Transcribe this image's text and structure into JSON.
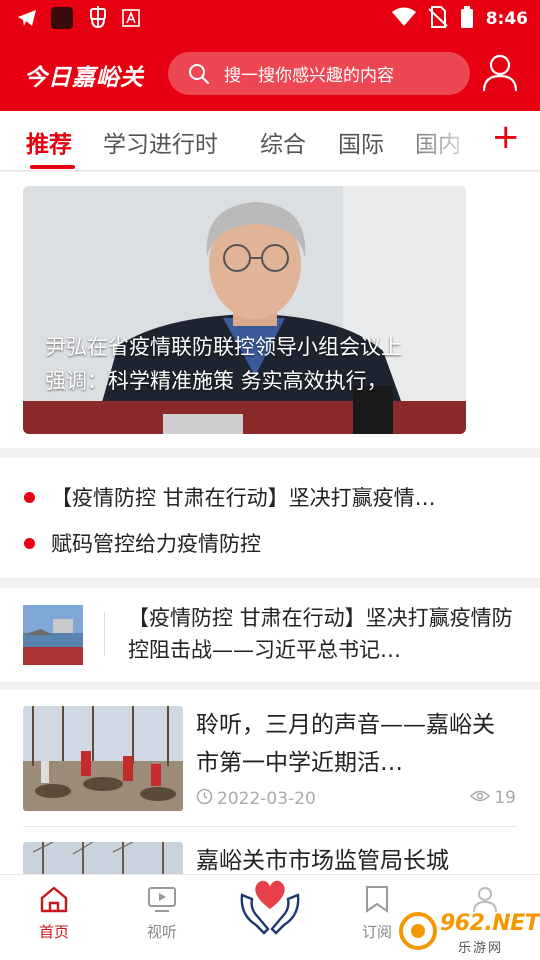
{
  "status_bar": {
    "time": "8:46",
    "icons": [
      "telegram-icon",
      "app-icon",
      "bug-icon",
      "letter-a-icon",
      "wifi-icon",
      "no-sim-icon",
      "battery-icon"
    ]
  },
  "header": {
    "logo_text": "今日嘉峪关",
    "search_placeholder": "搜一搜你感兴趣的内容"
  },
  "tabs": {
    "items": [
      {
        "label": "推荐",
        "active": true
      },
      {
        "label": "学习进行时",
        "active": false
      },
      {
        "label": "综合",
        "active": false
      },
      {
        "label": "国际",
        "active": false
      },
      {
        "label": "国内",
        "active": false
      }
    ],
    "add_label": "+"
  },
  "banner": {
    "caption_line1": "尹弘在省疫情联防联控领导小组会议上",
    "caption_line2": "强调：科学精准施策 务实高效执行，"
  },
  "headlines": [
    {
      "text": "【疫情防控 甘肃在行动】坚决打赢疫情…"
    },
    {
      "text": "赋码管控给力疫情防控"
    }
  ],
  "row_news": {
    "title": "【疫情防控 甘肃在行动】坚决打赢疫情防控阻击战——习近平总书记…"
  },
  "articles": [
    {
      "title": "聆听，三月的声音——嘉峪关市第一中学近期活…",
      "date": "2022-03-20",
      "views": "19"
    },
    {
      "title": "嘉峪关市市场监管局长城"
    }
  ],
  "bottom_nav": {
    "items": [
      {
        "label": "首页",
        "icon": "home-icon",
        "active": true
      },
      {
        "label": "视听",
        "icon": "video-icon",
        "active": false
      },
      {
        "label": "",
        "icon": "heart-hands-icon",
        "active": false
      },
      {
        "label": "订阅",
        "icon": "bookmark-icon",
        "active": false
      },
      {
        "label": "",
        "icon": "user-icon",
        "active": false
      }
    ]
  },
  "watermark": {
    "brand": "962.NET",
    "sub": "乐游网"
  },
  "colors": {
    "brand_red": "#e60012",
    "nav_active": "#c8161d",
    "watermark_orange": "#f39800"
  }
}
